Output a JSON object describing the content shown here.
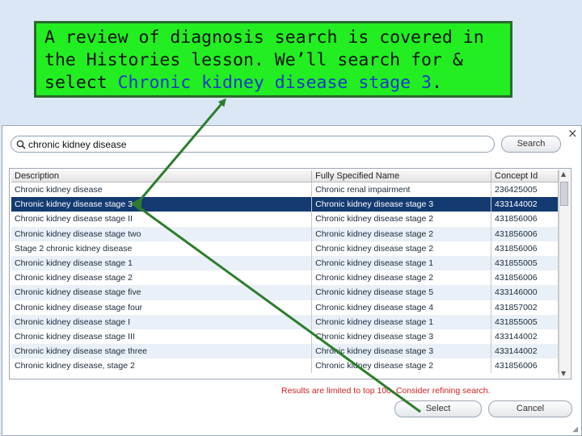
{
  "callout": {
    "text_before": "A review of diagnosis search is covered in the Histories lesson.  We’ll search for & select ",
    "highlight": "Chronic kidney disease stage 3",
    "text_after": "."
  },
  "search": {
    "value": "chronic kidney disease",
    "button": "Search"
  },
  "table": {
    "headers": [
      "Description",
      "Fully Specified Name",
      "Concept Id"
    ],
    "rows": [
      [
        "Chronic kidney disease",
        "Chronic renal impairment",
        "236425005"
      ],
      [
        "Chronic kidney disease stage 3",
        "Chronic kidney disease stage 3",
        "433144002"
      ],
      [
        "Chronic kidney disease stage II",
        "Chronic kidney disease stage 2",
        "431856006"
      ],
      [
        "Chronic kidney disease stage two",
        "Chronic kidney disease stage 2",
        "431856006"
      ],
      [
        "Stage 2 chronic kidney disease",
        "Chronic kidney disease stage 2",
        "431856006"
      ],
      [
        "Chronic kidney disease stage 1",
        "Chronic kidney disease stage 1",
        "431855005"
      ],
      [
        "Chronic kidney disease stage 2",
        "Chronic kidney disease stage 2",
        "431856006"
      ],
      [
        "Chronic kidney disease stage five",
        "Chronic kidney disease stage 5",
        "433146000"
      ],
      [
        "Chronic kidney disease stage four",
        "Chronic kidney disease stage 4",
        "431857002"
      ],
      [
        "Chronic kidney disease stage I",
        "Chronic kidney disease stage 1",
        "431855005"
      ],
      [
        "Chronic kidney disease stage III",
        "Chronic kidney disease stage 3",
        "433144002"
      ],
      [
        "Chronic kidney disease stage three",
        "Chronic kidney disease stage 3",
        "433144002"
      ],
      [
        "Chronic kidney disease, stage 2",
        "Chronic kidney disease stage 2",
        "431856006"
      ]
    ],
    "selected_index": 1
  },
  "notice": "Results are limited to top 100. Consider refining search.",
  "buttons": {
    "select": "Select",
    "cancel": "Cancel"
  },
  "close_glyph": "×",
  "colors": {
    "callout_bg": "#22ee22",
    "arrow": "#2e7d2e",
    "selection": "#143a72",
    "notice": "#d42020"
  },
  "icons": [
    "search-icon",
    "close-icon",
    "arrow-annotation"
  ]
}
